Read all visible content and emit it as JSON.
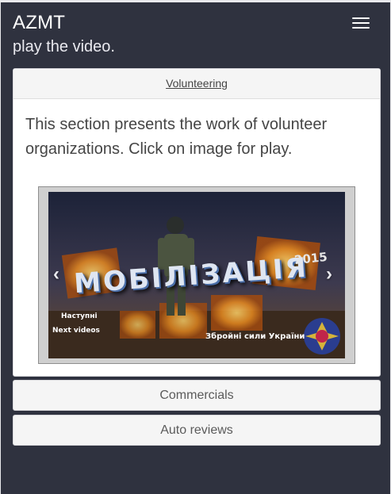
{
  "header": {
    "brand": "AZMT",
    "subtitle": "play the video."
  },
  "section": {
    "header_label": "Volunteering",
    "description": "This section presents the work of volunteer organizations. Click on image for play."
  },
  "carousel": {
    "title_text": "МОБІЛІЗАЦІЯ",
    "year_text": "2015",
    "next_label_ua": "Наступні",
    "next_label_en": "Next videos",
    "org_text": "Збройні сили України",
    "prev_icon": "chevron-left",
    "next_icon": "chevron-right"
  },
  "buttons": {
    "commercials": "Commercials",
    "auto_reviews": "Auto reviews"
  },
  "colors": {
    "background": "#2f323f",
    "panel": "#ffffff"
  }
}
